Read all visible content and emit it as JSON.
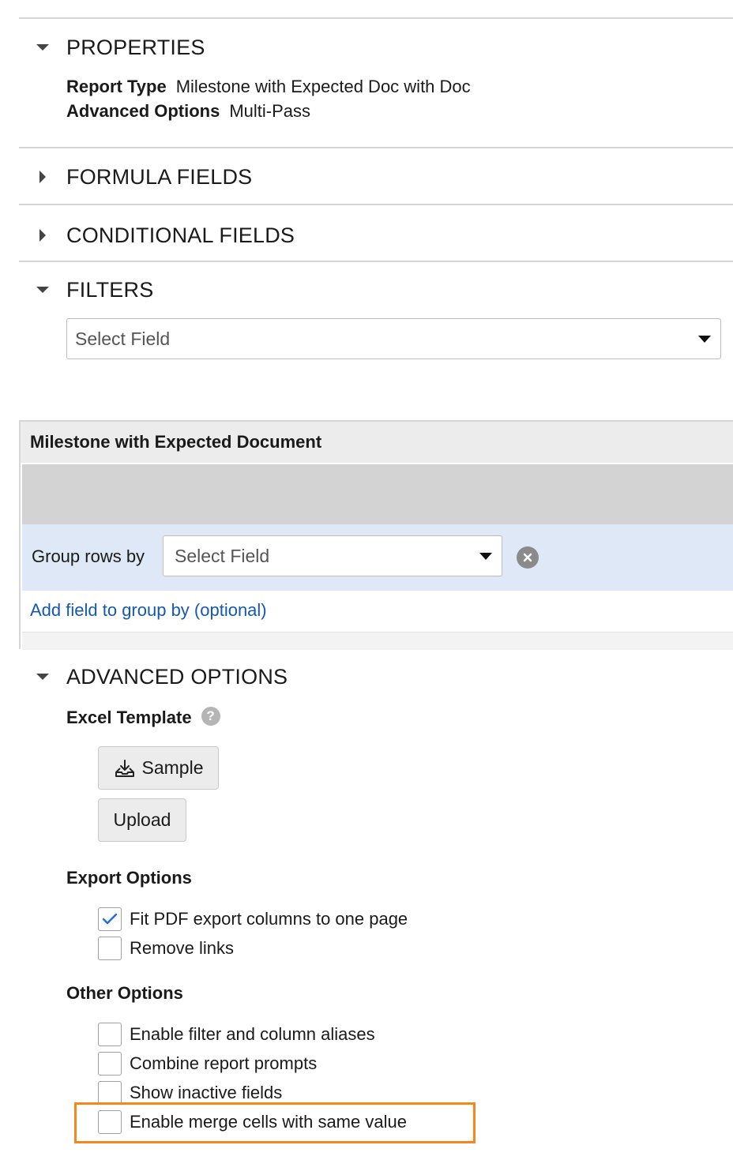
{
  "properties": {
    "title": "PROPERTIES",
    "report_type_label": "Report Type",
    "report_type_value": "Milestone with Expected Doc with Doc",
    "advanced_options_label": "Advanced Options",
    "advanced_options_value": "Multi-Pass"
  },
  "formula_fields": {
    "title": "FORMULA FIELDS"
  },
  "conditional_fields": {
    "title": "CONDITIONAL FIELDS"
  },
  "filters": {
    "title": "FILTERS",
    "select_placeholder": "Select Field"
  },
  "report_panel": {
    "title": "Milestone with Expected Document",
    "group_rows_label": "Group rows by",
    "group_select_placeholder": "Select Field",
    "add_group_link": "Add field to group by (optional)"
  },
  "advanced": {
    "title": "ADVANCED OPTIONS",
    "excel_template_label": "Excel Template",
    "help_glyph": "?",
    "sample_button": "Sample",
    "upload_button": "Upload",
    "export_options_label": "Export Options",
    "export_options": [
      {
        "label": "Fit PDF export columns to one page",
        "checked": true
      },
      {
        "label": "Remove links",
        "checked": false
      }
    ],
    "other_options_label": "Other Options",
    "other_options": [
      {
        "label": "Enable filter and column aliases",
        "checked": false
      },
      {
        "label": "Combine report prompts",
        "checked": false
      },
      {
        "label": "Show inactive fields",
        "checked": false
      },
      {
        "label": "Enable merge cells with same value",
        "checked": false
      }
    ]
  },
  "colors": {
    "link": "#1558b0",
    "highlight": "#f7871c",
    "group_bg": "#dfe8f6",
    "check": "#1f6fd1"
  },
  "icons": {
    "caret_expanded": "caret-down-icon",
    "caret_collapsed": "caret-right-icon",
    "dropdown": "dropdown-arrow-icon",
    "clear": "clear-x-icon",
    "help": "help-icon",
    "sample": "download-tray-icon",
    "checkmark": "checkmark-icon"
  }
}
